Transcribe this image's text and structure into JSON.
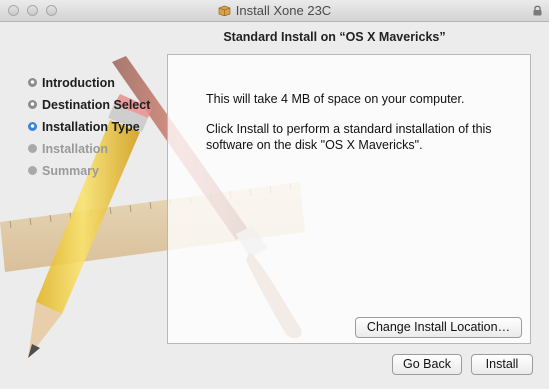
{
  "window": {
    "title": "Install Xone 23C",
    "icons": {
      "package": "package-icon",
      "lock": "lock-icon"
    }
  },
  "header": {
    "title": "Standard Install on “OS X Mavericks”"
  },
  "sidebar": {
    "steps": [
      {
        "label": "Introduction",
        "state": "done"
      },
      {
        "label": "Destination Select",
        "state": "done"
      },
      {
        "label": "Installation Type",
        "state": "active"
      },
      {
        "label": "Installation",
        "state": "pending"
      },
      {
        "label": "Summary",
        "state": "pending"
      }
    ]
  },
  "content": {
    "line1": "This will take 4 MB of space on your computer.",
    "line2": "Click Install to perform a standard installation of this software on the disk \"OS X Mavericks\".",
    "change_location_label": "Change Install Location…"
  },
  "footer": {
    "back_label": "Go Back",
    "install_label": "Install"
  },
  "colors": {
    "active_step": "#3b82d6",
    "window_bg": "#ececec"
  }
}
